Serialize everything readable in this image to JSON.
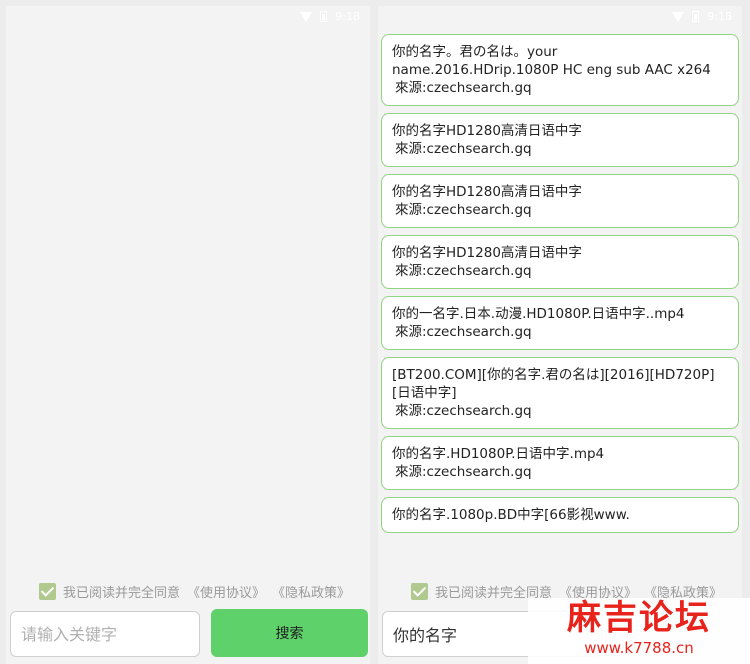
{
  "status_bar": {
    "time": "9:18"
  },
  "agreement": {
    "text": "我已阅读并完全同意",
    "terms_link": "《使用协议》",
    "privacy_link": "《隐私政策》"
  },
  "left_screen": {
    "search": {
      "value": "",
      "placeholder": "请输入关键字"
    },
    "search_button": "搜索"
  },
  "right_screen": {
    "search": {
      "value": "你的名字"
    },
    "results": [
      {
        "title": "你的名字。君の名は。your name.2016.HDrip.1080P HC eng sub AAC x264",
        "source": "來源:czechsearch.gq"
      },
      {
        "title": "你的名字HD1280高清日语中字",
        "source": "來源:czechsearch.gq"
      },
      {
        "title": "你的名字HD1280高清日语中字",
        "source": "來源:czechsearch.gq"
      },
      {
        "title": "你的名字HD1280高清日语中字",
        "source": "來源:czechsearch.gq"
      },
      {
        "title": "你的一名字.日本.动漫.HD1080P.日语中字..mp4",
        "source": "來源:czechsearch.gq"
      },
      {
        "title": "[BT200.COM][你的名字.君の名は][2016][HD720P][日语中字]",
        "source": "來源:czechsearch.gq"
      },
      {
        "title": "你的名字.HD1080P.日语中字.mp4",
        "source": "來源:czechsearch.gq"
      },
      {
        "title": "你的名字.1080p.BD中字[66影视www.",
        "source": ""
      }
    ]
  },
  "watermark": {
    "title": "麻吉论坛",
    "url": "www.k7788.cn"
  },
  "colors": {
    "accent": "#5fd16b",
    "card_border": "#8fd47f",
    "checkbox": "#b0c98f",
    "watermark": "#e8231c"
  }
}
